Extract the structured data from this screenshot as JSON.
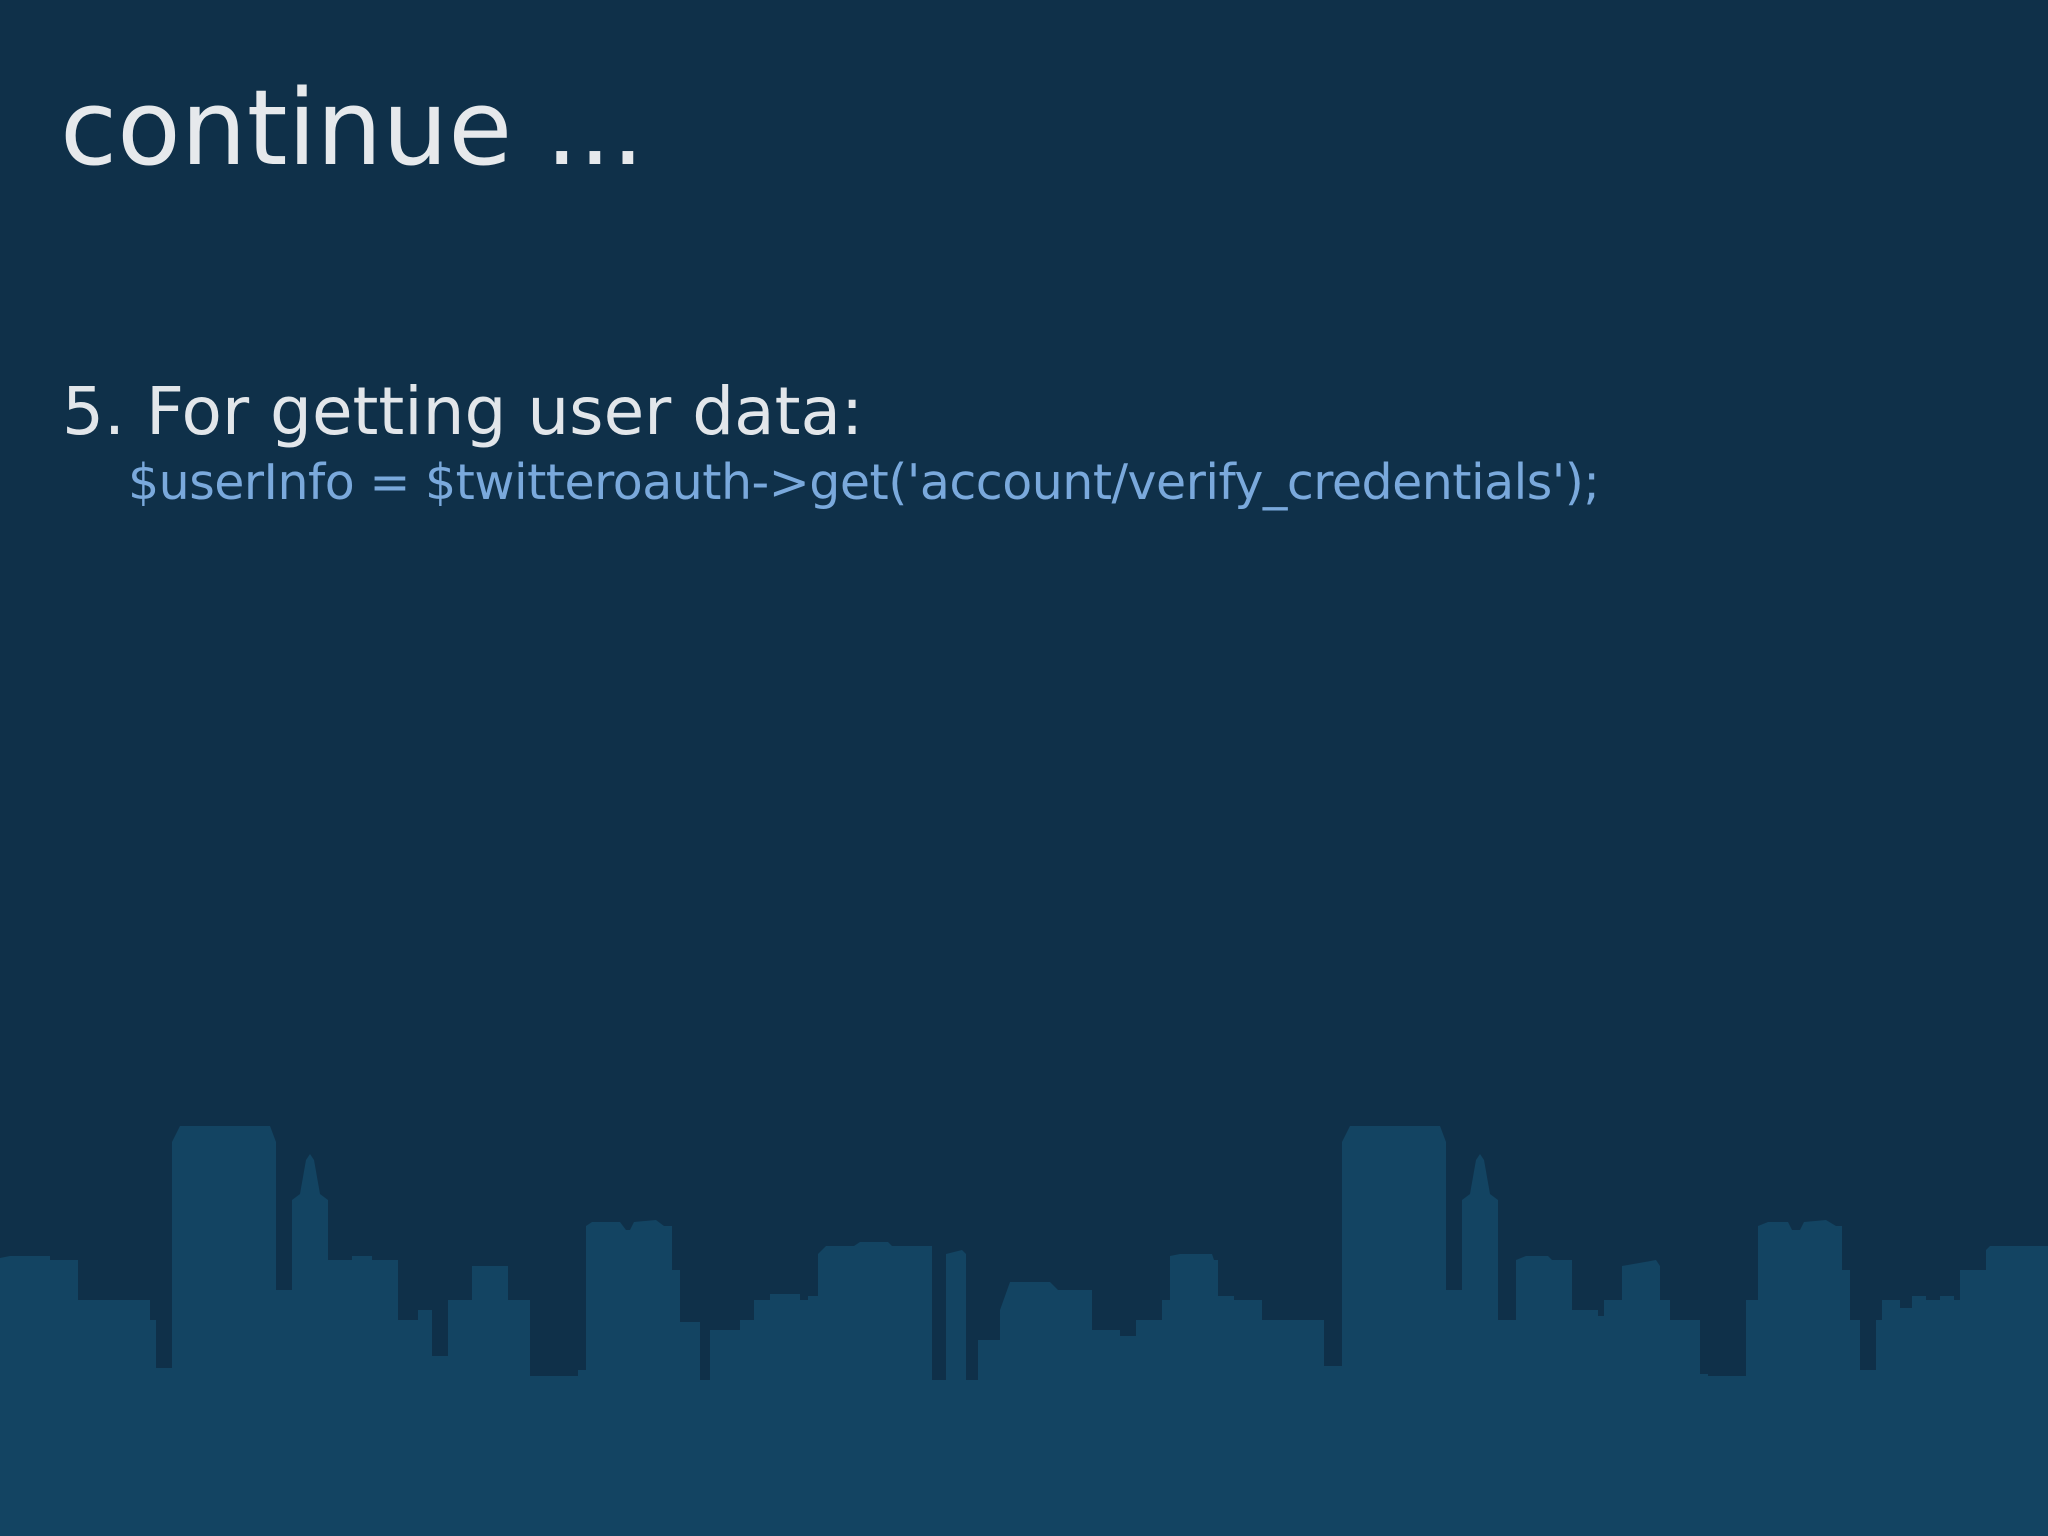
{
  "slide": {
    "title": "continue ...",
    "item": {
      "text": "5. For getting user data:",
      "code": "$userInfo = $twitteroauth->get('account/verify_credentials');"
    }
  },
  "colors": {
    "background": "#0f3049",
    "skyline": "#134462",
    "title_text": "#e6e9ec",
    "code_text": "#7aa9dc"
  }
}
